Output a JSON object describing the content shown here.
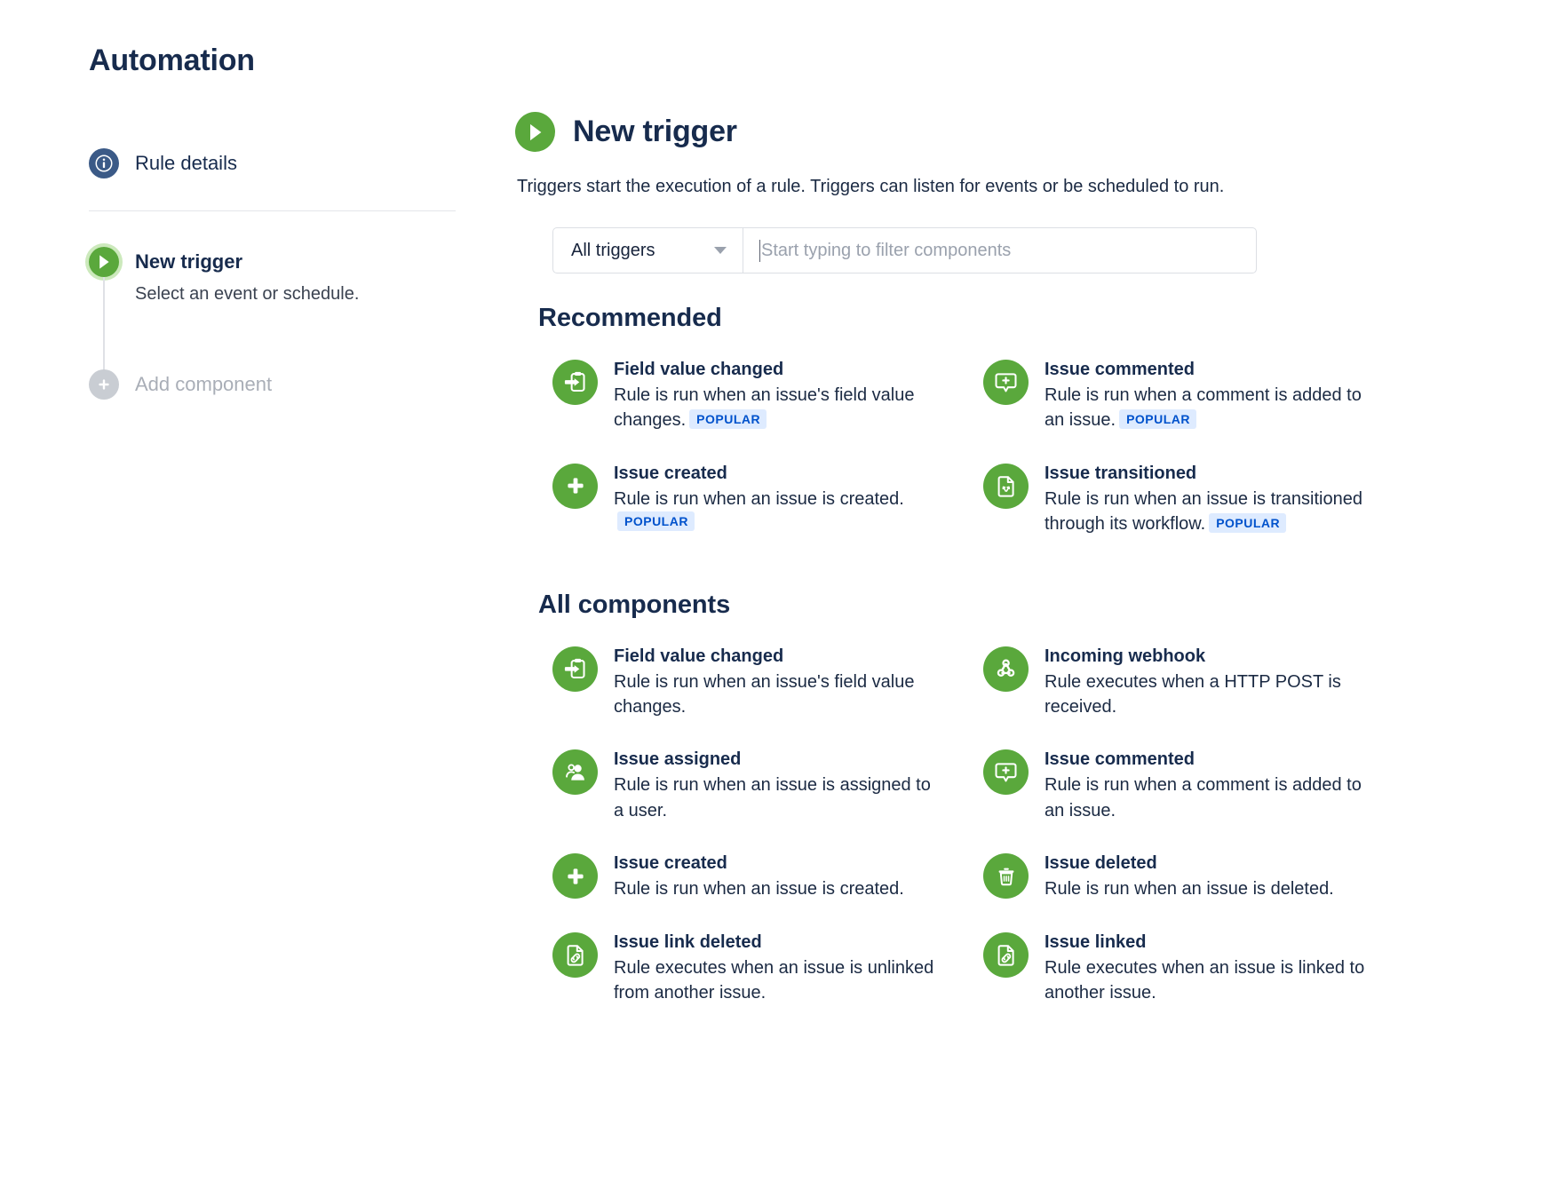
{
  "page": {
    "title": "Automation"
  },
  "rail": {
    "steps": [
      {
        "label": "Rule details",
        "sub": "",
        "icon": "info-circle-icon",
        "state": "default"
      },
      {
        "label": "New trigger",
        "sub": "Select an event or schedule.",
        "icon": "play-icon",
        "state": "active"
      },
      {
        "label": "Add component",
        "sub": "",
        "icon": "plus-icon",
        "state": "muted"
      }
    ]
  },
  "main": {
    "heading": "New trigger",
    "heading_icon": "play-icon",
    "description": "Triggers start the execution of a rule. Triggers can listen for events or be scheduled to run.",
    "filter": {
      "select_value": "All triggers",
      "select_icon": "chevron-down-icon",
      "input_value": "",
      "input_placeholder": "Start typing to filter components"
    },
    "sections": [
      {
        "title": "Recommended",
        "components": [
          {
            "title": "Field value changed",
            "desc": "Rule is run when an issue's field value changes.",
            "badge": "POPULAR",
            "icon": "field-value-changed-icon"
          },
          {
            "title": "Issue commented",
            "desc": "Rule is run when a comment is added to an issue.",
            "badge": "POPULAR",
            "icon": "comment-plus-icon"
          },
          {
            "title": "Issue created",
            "desc": "Rule is run when an issue is created.",
            "badge": "POPULAR",
            "icon": "plus-icon"
          },
          {
            "title": "Issue transitioned",
            "desc": "Rule is run when an issue is transitioned through its workflow.",
            "badge": "POPULAR",
            "icon": "page-transition-icon"
          }
        ]
      },
      {
        "title": "All components",
        "components": [
          {
            "title": "Field value changed",
            "desc": "Rule is run when an issue's field value changes.",
            "badge": "",
            "icon": "field-value-changed-icon"
          },
          {
            "title": "Incoming webhook",
            "desc": "Rule executes when a HTTP POST is received.",
            "badge": "",
            "icon": "webhook-icon"
          },
          {
            "title": "Issue assigned",
            "desc": "Rule is run when an issue is assigned to a user.",
            "badge": "",
            "icon": "person-assign-icon"
          },
          {
            "title": "Issue commented",
            "desc": "Rule is run when a comment is added to an issue.",
            "badge": "",
            "icon": "comment-plus-icon"
          },
          {
            "title": "Issue created",
            "desc": "Rule is run when an issue is created.",
            "badge": "",
            "icon": "plus-icon"
          },
          {
            "title": "Issue deleted",
            "desc": "Rule is run when an issue is deleted.",
            "badge": "",
            "icon": "trash-icon"
          },
          {
            "title": "Issue link deleted",
            "desc": "Rule executes when an issue is unlinked from another issue.",
            "badge": "",
            "icon": "page-link-icon"
          },
          {
            "title": "Issue linked",
            "desc": "Rule executes when an issue is linked to another issue.",
            "badge": "",
            "icon": "page-link-icon"
          }
        ]
      }
    ]
  },
  "colors": {
    "green": "#5aa83c",
    "navy": "#172b4d",
    "badge_bg": "#deebff",
    "badge_fg": "#0052cc",
    "info_blue": "#3b5a87",
    "muted_grey": "#c9cdd3"
  }
}
